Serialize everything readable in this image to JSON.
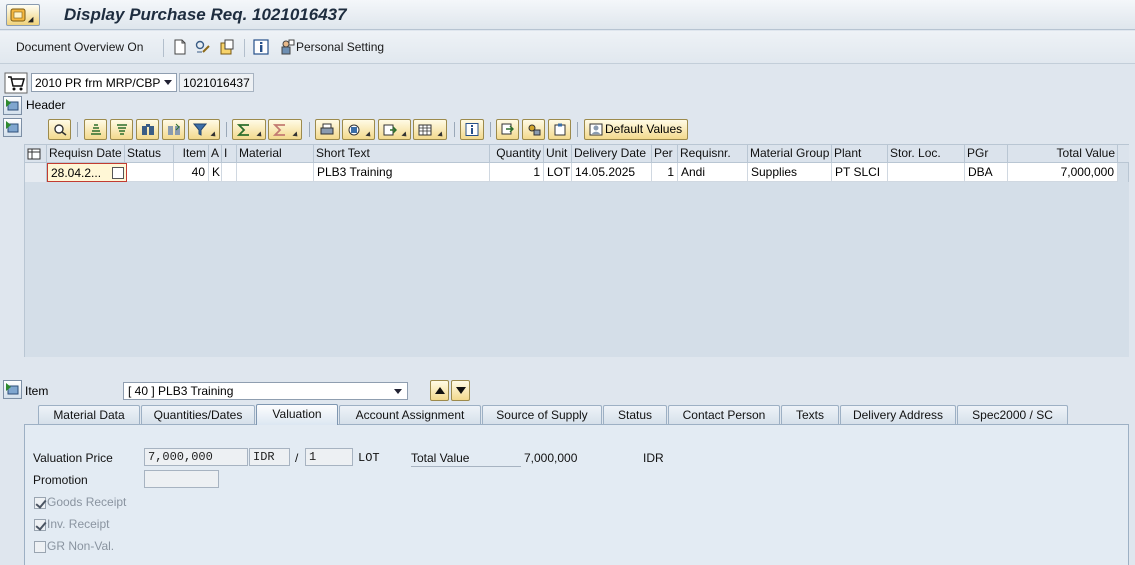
{
  "window": {
    "title": "Display Purchase Req. 1021016437"
  },
  "app_toolbar": {
    "document_overview": "Document Overview On",
    "personal_setting": "Personal Setting",
    "icons": [
      "new-document-icon",
      "display-change-icon",
      "other-document-icon",
      "info-icon",
      "personal-setting-icon"
    ]
  },
  "document": {
    "type": "2010 PR frm MRP/CBP",
    "number": "1021016437",
    "header_label": "Header"
  },
  "grid_toolbar": {
    "default_values": "Default Values"
  },
  "items_table": {
    "columns": [
      "Requisn Date",
      "Status",
      "Item",
      "A",
      "I",
      "Material",
      "Short Text",
      "Quantity",
      "Unit",
      "Delivery Date",
      "Per",
      "Requisnr.",
      "Material Group",
      "Plant",
      "Stor. Loc.",
      "PGr",
      "Total Value"
    ],
    "rows": [
      {
        "requisn_date": "28.04.2...",
        "status": "",
        "item": "40",
        "a": "K",
        "i": "",
        "material": "",
        "short_text": "PLB3 Training",
        "quantity": "1",
        "unit": "LOT",
        "delivery_date": "14.05.2025",
        "per": "1",
        "requisnr": "Andi",
        "material_group": "Supplies",
        "plant": "PT SLCI",
        "stor_loc": "",
        "pgr": "DBA",
        "total_value": "7,000,000"
      }
    ]
  },
  "item_detail": {
    "label": "Item",
    "selected": "[ 40 ] PLB3 Training",
    "tabs": [
      "Material Data",
      "Quantities/Dates",
      "Valuation",
      "Account Assignment",
      "Source of Supply",
      "Status",
      "Contact Person",
      "Texts",
      "Delivery Address",
      "Spec2000 / SC"
    ],
    "active_tab": "Valuation"
  },
  "valuation": {
    "valuation_price_label": "Valuation Price",
    "valuation_price": "7,000,000",
    "currency": "IDR",
    "slash": "/",
    "price_unit": "1",
    "unit": "LOT",
    "total_value_label": "Total Value",
    "total_value": "7,000,000",
    "total_currency": "IDR",
    "promotion_label": "Promotion",
    "promotion": "",
    "goods_receipt_label": "Goods Receipt",
    "goods_receipt": true,
    "inv_receipt_label": "Inv. Receipt",
    "inv_receipt": true,
    "gr_nonval_label": "GR Non-Val.",
    "gr_nonval": false
  },
  "colors": {
    "background": "#dfe6ee",
    "button_gold": "#f3d98d",
    "error_border": "#c23b31"
  }
}
